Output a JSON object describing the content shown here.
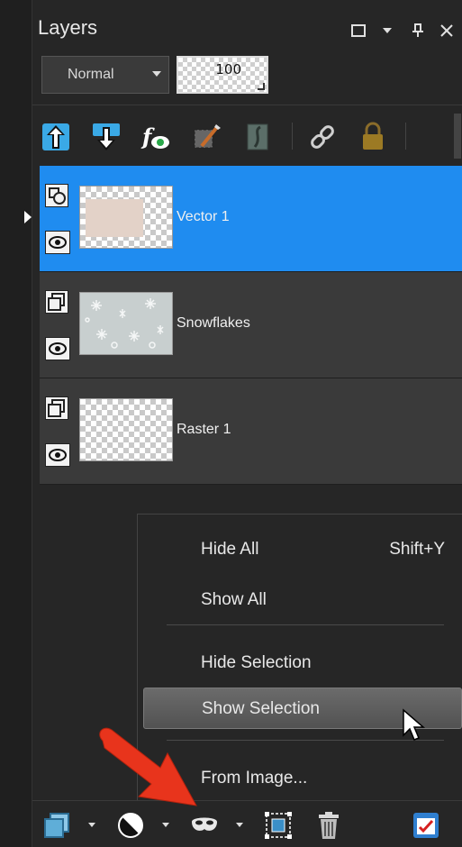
{
  "panel": {
    "title": "Layers",
    "blend_mode": "Normal",
    "opacity": "100"
  },
  "toolbar": {
    "icons": [
      "move-layer-up-icon",
      "move-layer-down-icon",
      "layer-effects-icon",
      "edit-style-icon",
      "layer-mask-icon",
      "link-icon",
      "lock-icon"
    ]
  },
  "layers": [
    {
      "name": "Vector 1",
      "type": "vector",
      "selected": true
    },
    {
      "name": "Snowflakes",
      "type": "raster",
      "selected": false
    },
    {
      "name": "Raster 1",
      "type": "raster",
      "selected": false
    }
  ],
  "menu": {
    "items": [
      {
        "label": "Hide All",
        "shortcut": "Shift+Y"
      },
      {
        "label": "Show All",
        "shortcut": ""
      },
      {
        "label": "Hide Selection",
        "shortcut": ""
      },
      {
        "label": "Show Selection",
        "shortcut": "",
        "highlighted": true
      },
      {
        "label": "From Image...",
        "shortcut": ""
      }
    ]
  },
  "colors": {
    "selection": "#1f8cf0",
    "panel_bg": "#262626",
    "arrow_red": "#e8341c"
  }
}
